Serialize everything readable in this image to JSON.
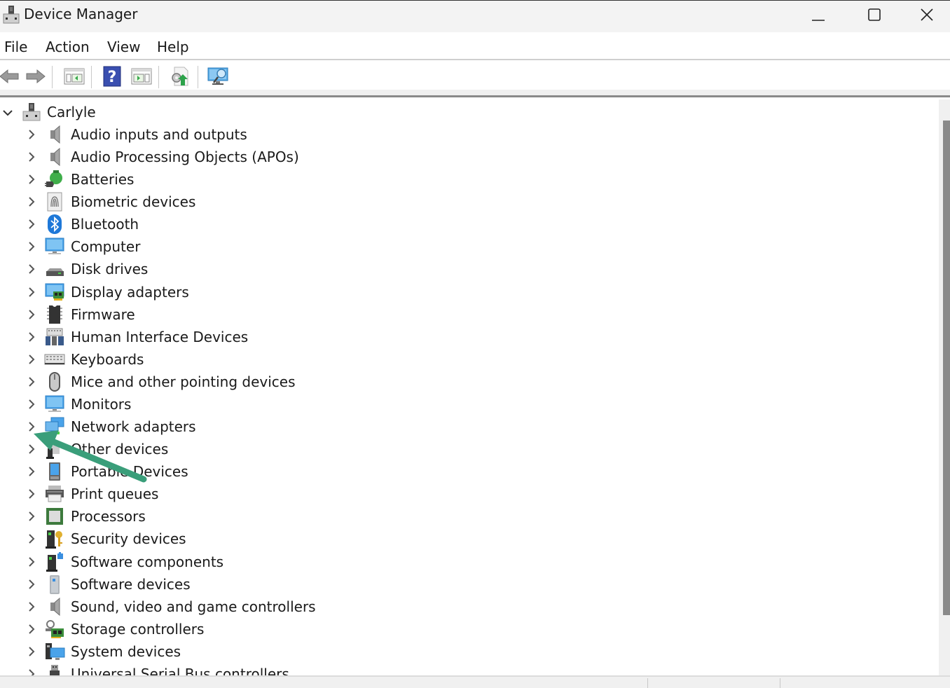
{
  "window": {
    "title": "Device Manager",
    "app_icon": "device-manager-icon",
    "controls": [
      "minimize",
      "maximize",
      "close"
    ]
  },
  "menu": {
    "items": [
      {
        "label": "File"
      },
      {
        "label": "Action"
      },
      {
        "label": "View"
      },
      {
        "label": "Help"
      }
    ]
  },
  "toolbar": {
    "buttons": [
      {
        "name": "back",
        "icon": "back-arrow-icon"
      },
      {
        "name": "forward",
        "icon": "forward-arrow-icon"
      },
      {
        "name": "show-hide-console-tree",
        "icon": "console-tree-icon"
      },
      {
        "name": "help",
        "icon": "help-icon"
      },
      {
        "name": "show-hide-action-pane",
        "icon": "action-pane-icon"
      },
      {
        "name": "update-driver",
        "icon": "update-driver-icon"
      },
      {
        "name": "scan-hardware-changes",
        "icon": "scan-hardware-icon"
      }
    ]
  },
  "tree": {
    "root": {
      "label": "Carlyle",
      "expanded": true,
      "icon": "computer-root-icon"
    },
    "categories": [
      {
        "label": "Audio inputs and outputs",
        "icon": "speaker-icon"
      },
      {
        "label": "Audio Processing Objects (APOs)",
        "icon": "speaker-icon"
      },
      {
        "label": "Batteries",
        "icon": "battery-icon"
      },
      {
        "label": "Biometric devices",
        "icon": "fingerprint-icon"
      },
      {
        "label": "Bluetooth",
        "icon": "bluetooth-icon"
      },
      {
        "label": "Computer",
        "icon": "computer-icon"
      },
      {
        "label": "Disk drives",
        "icon": "disk-drive-icon"
      },
      {
        "label": "Display adapters",
        "icon": "display-adapter-icon"
      },
      {
        "label": "Firmware",
        "icon": "chip-icon"
      },
      {
        "label": "Human Interface Devices",
        "icon": "hid-icon"
      },
      {
        "label": "Keyboards",
        "icon": "keyboard-icon"
      },
      {
        "label": "Mice and other pointing devices",
        "icon": "mouse-icon"
      },
      {
        "label": "Monitors",
        "icon": "monitor-icon"
      },
      {
        "label": "Network adapters",
        "icon": "network-adapter-icon"
      },
      {
        "label": "Other devices",
        "icon": "other-device-icon"
      },
      {
        "label": "Portable Devices",
        "icon": "portable-device-icon"
      },
      {
        "label": "Print queues",
        "icon": "printer-icon"
      },
      {
        "label": "Processors",
        "icon": "processor-icon"
      },
      {
        "label": "Security devices",
        "icon": "security-device-icon"
      },
      {
        "label": "Software components",
        "icon": "software-component-icon"
      },
      {
        "label": "Software devices",
        "icon": "software-device-icon"
      },
      {
        "label": "Sound, video and game controllers",
        "icon": "speaker-icon"
      },
      {
        "label": "Storage controllers",
        "icon": "storage-controller-icon"
      },
      {
        "label": "System devices",
        "icon": "system-device-icon"
      },
      {
        "label": "Universal Serial Bus controllers",
        "icon": "usb-icon"
      }
    ]
  },
  "annotation": {
    "type": "arrow",
    "color": "#3a9e7a",
    "points_to": "Network adapters expand chevron"
  },
  "colors": {
    "titlebar_bg": "#f3f3f3",
    "scroll_thumb": "#8a8a8a",
    "bluetooth_blue": "#1e78d8"
  }
}
